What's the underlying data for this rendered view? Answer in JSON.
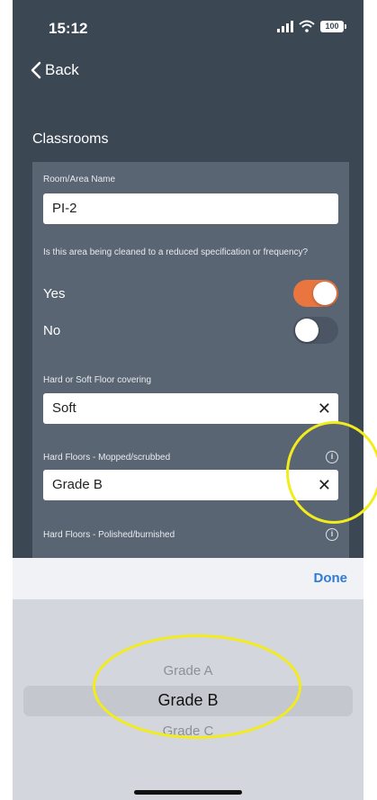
{
  "status_bar": {
    "time": "15:12",
    "battery": "100"
  },
  "nav": {
    "back_label": "Back"
  },
  "section_title": "Classrooms",
  "form": {
    "room_label": "Room/Area Name",
    "room_value": "PI-2",
    "reduced_question": "Is this area being cleaned to a reduced specification or frequency?",
    "yes_label": "Yes",
    "no_label": "No",
    "yes_on": true,
    "no_on": false,
    "floor_label": "Hard or Soft Floor covering",
    "floor_value": "Soft",
    "mopped_label": "Hard Floors - Mopped/scrubbed",
    "mopped_value": "Grade B",
    "polished_label": "Hard Floors - Polished/burnished"
  },
  "picker": {
    "done_label": "Done",
    "options": [
      "Grade A",
      "Grade B",
      "Grade C"
    ],
    "selected": "Grade B"
  },
  "colors": {
    "background": "#3c4754",
    "card": "#5a6573",
    "toggle_on": "#e9763f",
    "highlight": "#f2ec1c",
    "done": "#2f7bd6"
  }
}
